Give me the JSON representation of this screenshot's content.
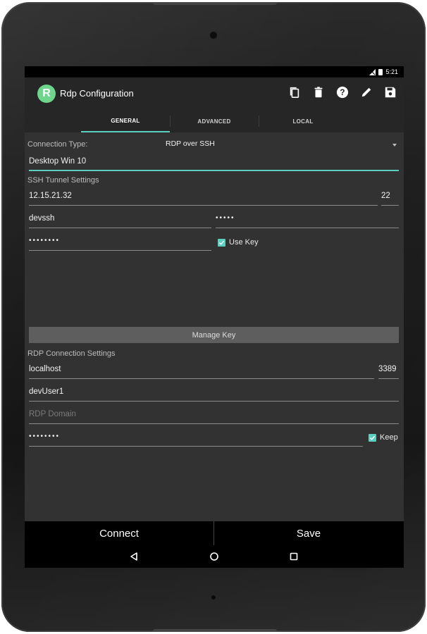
{
  "status_bar": {
    "time": "5:21"
  },
  "app_bar": {
    "logo_letter": "R",
    "title": "Rdp Configuration",
    "actions": [
      "copy-icon",
      "delete-icon",
      "help-icon",
      "edit-icon",
      "save-icon"
    ]
  },
  "tabs": [
    {
      "label": "GENERAL",
      "active": true
    },
    {
      "label": "ADVANCED",
      "active": false
    },
    {
      "label": "LOCAL",
      "active": false
    }
  ],
  "general": {
    "connection_type_label": "Connection Type:",
    "connection_type_value": "RDP over SSH",
    "connection_name": "Desktop Win 10",
    "ssh_section_label": "SSH Tunnel Settings",
    "ssh_host": "12.15.21.32",
    "ssh_port": "22",
    "ssh_user": "devssh",
    "ssh_user_password": "•••••",
    "ssh_key_password": "••••••••",
    "use_key_label": "Use Key",
    "manage_key_label": "Manage Key",
    "rdp_section_label": "RDP Connection Settings",
    "rdp_host": "localhost",
    "rdp_port": "3389",
    "rdp_user": "devUser1",
    "rdp_domain_placeholder": "RDP Domain",
    "rdp_password": "••••••••",
    "keep_label": "Keep"
  },
  "bottom_bar": {
    "connect_label": "Connect",
    "save_label": "Save"
  },
  "colors": {
    "accent": "#5ccfc0",
    "logo": "#6dd58c",
    "background": "#323232"
  }
}
